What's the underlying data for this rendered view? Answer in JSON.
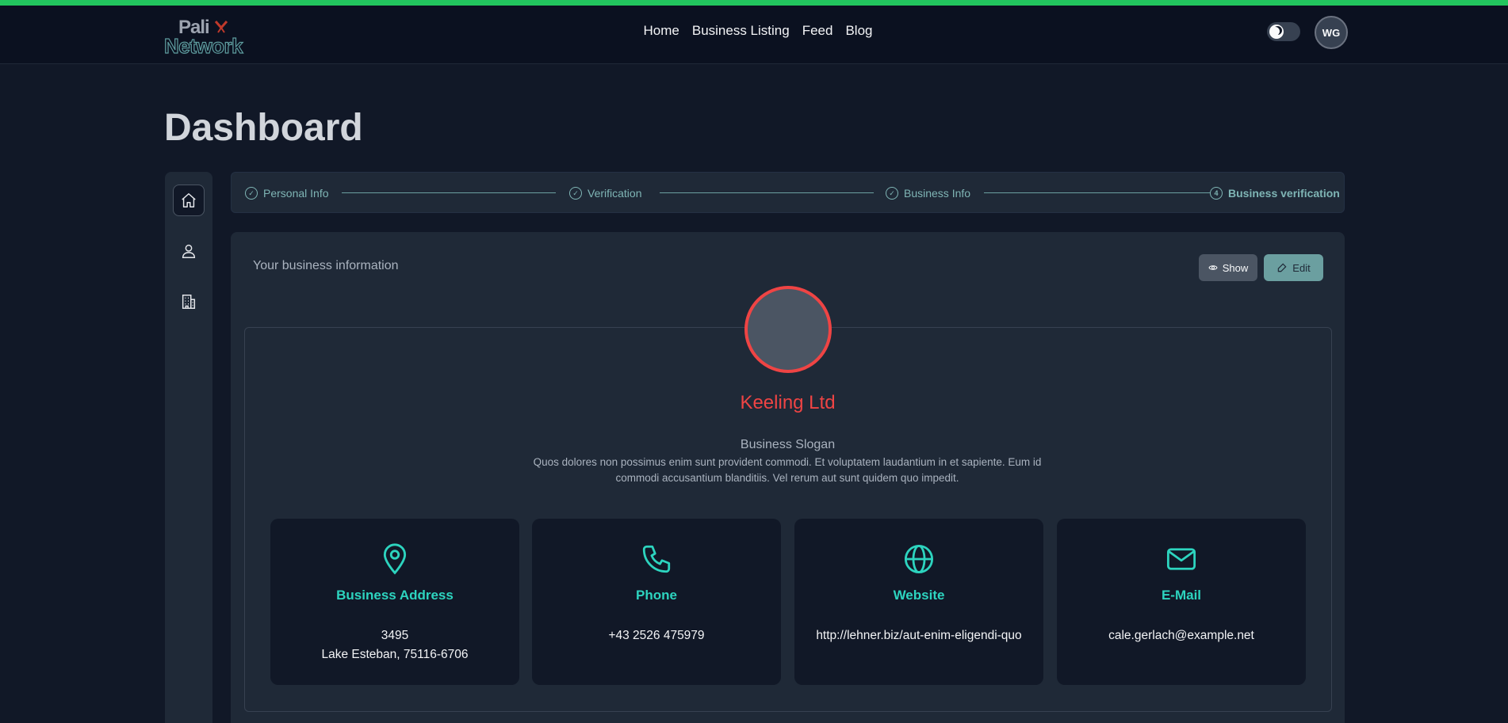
{
  "brand": {
    "line1": "Pali",
    "line2": "Network"
  },
  "nav": {
    "links": [
      "Home",
      "Business Listing",
      "Feed",
      "Blog"
    ]
  },
  "user": {
    "initials": "WG"
  },
  "page": {
    "title": "Dashboard"
  },
  "sidebar": {
    "items": [
      "home-icon",
      "user-icon",
      "building-icon"
    ]
  },
  "stepper": {
    "steps": [
      {
        "label": "Personal Info",
        "state": "done"
      },
      {
        "label": "Verification",
        "state": "done"
      },
      {
        "label": "Business Info",
        "state": "done"
      },
      {
        "label": "Business verification",
        "state": "current",
        "number": "4"
      }
    ]
  },
  "card": {
    "title": "Your business information",
    "show_label": "Show",
    "edit_label": "Edit"
  },
  "business": {
    "name": "Keeling Ltd",
    "slogan_label": "Business Slogan",
    "description": "Quos dolores non possimus enim sunt provident commodi. Et voluptatem laudantium in et sapiente. Eum id commodi accusantium blanditiis. Vel rerum aut sunt quidem quo impedit.",
    "info": [
      {
        "icon": "map-pin-icon",
        "title": "Business Address",
        "value_line1": "3495",
        "value_line2": "Lake Esteban, 75116-6706"
      },
      {
        "icon": "phone-icon",
        "title": "Phone",
        "value_line1": "+43 2526 475979"
      },
      {
        "icon": "globe-icon",
        "title": "Website",
        "value_line1": "http://lehner.biz/aut-enim-eligendi-quo"
      },
      {
        "icon": "mail-icon",
        "title": "E-Mail",
        "value_line1": "cale.gerlach@example.net"
      }
    ]
  },
  "colors": {
    "accent_bar": "#22c55e",
    "teal": "#2dd4bf",
    "brand_red": "#ef4444",
    "muted_teal": "#6b9fa0"
  }
}
